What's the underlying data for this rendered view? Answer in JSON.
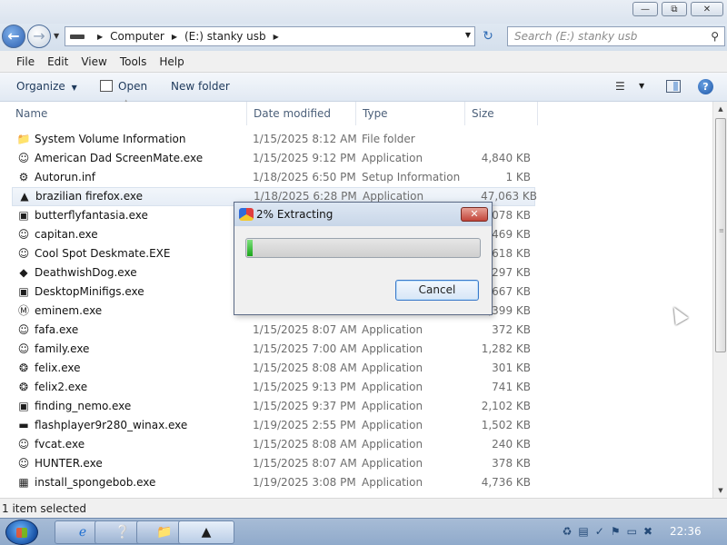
{
  "window": {
    "minimize_glyph": "—",
    "maximize_glyph": "⧉",
    "close_glyph": "✕"
  },
  "address": {
    "crumbs": [
      "Computer",
      "(E:) stanky usb"
    ],
    "search_placeholder": "Search (E:) stanky usb"
  },
  "menu": [
    "File",
    "Edit",
    "View",
    "Tools",
    "Help"
  ],
  "toolbar": {
    "organize": "Organize",
    "open": "Open",
    "new_folder": "New folder"
  },
  "columns": {
    "name": "Name",
    "date": "Date modified",
    "type": "Type",
    "size": "Size"
  },
  "files": [
    {
      "name": "System Volume Information",
      "date": "1/15/2025 8:12 AM",
      "type": "File folder",
      "size": "",
      "icon": "folder-icon",
      "glyph": "📁"
    },
    {
      "name": "American Dad ScreenMate.exe",
      "date": "1/15/2025 9:12 PM",
      "type": "Application",
      "size": "4,840 KB",
      "icon": "character-icon",
      "glyph": "☺"
    },
    {
      "name": "Autorun.inf",
      "date": "1/18/2025 6:50 PM",
      "type": "Setup Information",
      "size": "1 KB",
      "icon": "settings-file-icon",
      "glyph": "⚙"
    },
    {
      "name": "brazilian firefox.exe",
      "date": "1/18/2025 6:28 PM",
      "type": "Application",
      "size": "47,063 KB",
      "icon": "colorful-app-icon",
      "glyph": "▲",
      "selected": true
    },
    {
      "name": "butterflyfantasia.exe",
      "date": "",
      "type": "",
      "size": "1,078 KB",
      "icon": "app-window-icon",
      "glyph": "▣"
    },
    {
      "name": "capitan.exe",
      "date": "",
      "type": "",
      "size": "469 KB",
      "icon": "character-icon",
      "glyph": "☺"
    },
    {
      "name": "Cool Spot Deskmate.EXE",
      "date": "",
      "type": "",
      "size": "1,618 KB",
      "icon": "character-icon",
      "glyph": "☺"
    },
    {
      "name": "DeathwishDog.exe",
      "date": "",
      "type": "",
      "size": "297 KB",
      "icon": "dog-icon",
      "glyph": "◆"
    },
    {
      "name": "DesktopMinifigs.exe",
      "date": "",
      "type": "",
      "size": "1,667 KB",
      "icon": "app-window-icon",
      "glyph": "▣"
    },
    {
      "name": "eminem.exe",
      "date": "",
      "type": "",
      "size": "1,399 KB",
      "icon": "red-m-icon",
      "glyph": "Ⓜ"
    },
    {
      "name": "fafa.exe",
      "date": "1/15/2025 8:07 AM",
      "type": "Application",
      "size": "372 KB",
      "icon": "cat-icon",
      "glyph": "☺"
    },
    {
      "name": "family.exe",
      "date": "1/15/2025 7:00 AM",
      "type": "Application",
      "size": "1,282 KB",
      "icon": "character-icon",
      "glyph": "☺"
    },
    {
      "name": "felix.exe",
      "date": "1/15/2025 8:08 AM",
      "type": "Application",
      "size": "301 KB",
      "icon": "paw-icon",
      "glyph": "❂"
    },
    {
      "name": "felix2.exe",
      "date": "1/15/2025 9:13 PM",
      "type": "Application",
      "size": "741 KB",
      "icon": "paw-icon",
      "glyph": "❂"
    },
    {
      "name": "finding_nemo.exe",
      "date": "1/15/2025 9:37 PM",
      "type": "Application",
      "size": "2,102 KB",
      "icon": "app-window-icon",
      "glyph": "▣"
    },
    {
      "name": "flashplayer9r280_winax.exe",
      "date": "1/19/2025 2:55 PM",
      "type": "Application",
      "size": "1,502 KB",
      "icon": "flash-icon",
      "glyph": "▬"
    },
    {
      "name": "fvcat.exe",
      "date": "1/15/2025 8:08 AM",
      "type": "Application",
      "size": "240 KB",
      "icon": "cat-icon",
      "glyph": "☺"
    },
    {
      "name": "HUNTER.exe",
      "date": "1/15/2025 8:07 AM",
      "type": "Application",
      "size": "378 KB",
      "icon": "character-icon",
      "glyph": "☺"
    },
    {
      "name": "install_spongebob.exe",
      "date": "1/19/2025 3:08 PM",
      "type": "Application",
      "size": "4,736 KB",
      "icon": "spongebob-icon",
      "glyph": "▦"
    }
  ],
  "status": {
    "text": "1 item selected"
  },
  "dialog": {
    "title": "2% Extracting",
    "progress": 0.02,
    "cancel": "Cancel"
  },
  "taskbar": {
    "clock": "22:36"
  }
}
